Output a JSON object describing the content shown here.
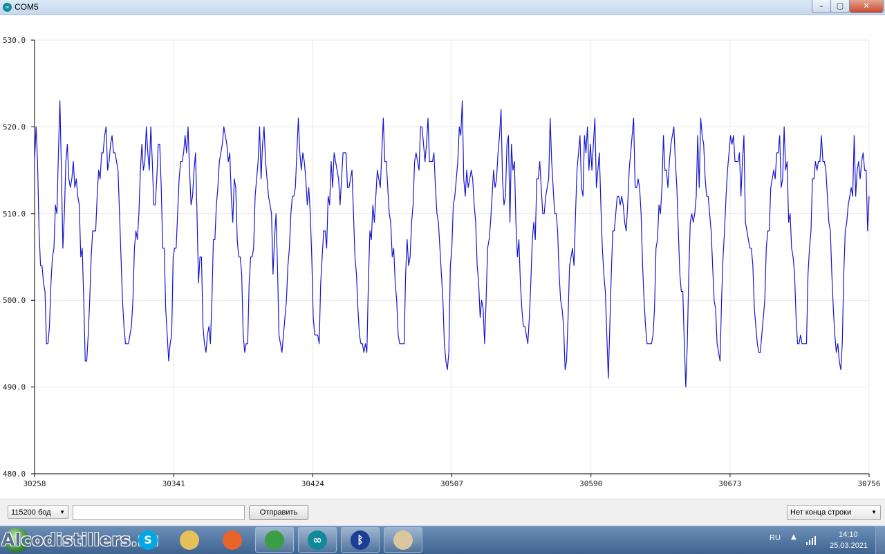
{
  "window": {
    "title": "COM5",
    "min_glyph": "–",
    "max_glyph": "▢",
    "close_glyph": "✕"
  },
  "chart_data": {
    "type": "line",
    "title": "",
    "xlabel": "",
    "ylabel": "",
    "xlim": [
      30258,
      30756
    ],
    "ylim": [
      480,
      530
    ],
    "x_ticks": [
      "30258",
      "30341",
      "30424",
      "30507",
      "30590",
      "30673",
      "30756"
    ],
    "y_ticks": [
      "480.0",
      "490.0",
      "500.0",
      "510.0",
      "520.0",
      "530.0"
    ],
    "grid": true,
    "series": [
      {
        "color": "#1515d0",
        "x_start": 30258,
        "x_step": 1,
        "values": [
          516,
          520,
          516,
          508,
          504,
          504,
          502,
          501,
          495,
          495,
          497,
          502,
          505,
          506,
          511,
          510,
          517,
          523,
          515,
          506,
          510,
          516,
          518,
          514,
          513,
          514,
          516,
          513,
          514,
          512,
          511,
          505,
          506,
          500,
          493,
          493,
          496,
          500,
          505,
          508,
          508,
          508,
          512,
          515,
          514,
          517,
          517,
          519,
          520,
          515,
          516,
          518,
          519,
          517,
          517,
          516,
          515,
          510,
          505,
          500,
          497,
          495,
          495,
          495,
          496,
          497,
          500,
          506,
          508,
          507,
          510,
          515,
          518,
          515,
          516,
          520,
          517,
          515,
          520,
          516,
          511,
          511,
          514,
          518,
          518,
          513,
          506,
          506,
          499,
          496,
          493,
          495,
          496,
          505,
          506,
          506,
          510,
          514,
          516,
          516,
          517,
          519,
          517,
          520,
          515,
          511,
          512,
          515,
          517,
          510,
          502,
          505,
          505,
          497,
          495,
          494,
          496,
          497,
          495,
          500,
          507,
          507,
          511,
          513,
          516,
          517,
          518,
          520,
          519,
          518,
          516,
          517,
          512,
          509,
          514,
          513,
          507,
          505,
          505,
          503,
          496,
          494,
          495,
          495,
          502,
          505,
          505,
          506,
          512,
          514,
          516,
          520,
          514,
          518,
          520,
          516,
          514,
          512,
          511,
          510,
          503,
          507,
          510,
          504,
          496,
          495,
          494,
          496,
          498,
          500,
          504,
          506,
          510,
          512,
          512,
          513,
          517,
          521,
          517,
          515,
          517,
          516,
          514,
          511,
          513,
          510,
          505,
          498,
          496,
          496,
          496,
          495,
          502,
          505,
          508,
          508,
          506,
          512,
          511,
          516,
          513,
          517,
          516,
          515,
          514,
          511,
          514,
          517,
          517,
          517,
          513,
          513,
          514,
          515,
          510,
          505,
          503,
          499,
          496,
          495,
          495,
          494,
          495,
          494,
          502,
          508,
          507,
          511,
          509,
          512,
          515,
          514,
          513,
          517,
          521,
          516,
          516,
          513,
          510,
          509,
          505,
          506,
          502,
          500,
          496,
          495,
          495,
          495,
          495,
          503,
          507,
          504,
          505,
          509,
          511,
          516,
          517,
          516,
          515,
          520,
          520,
          518,
          516,
          518,
          521,
          516,
          516,
          516,
          517,
          513,
          510,
          509,
          506,
          503,
          500,
          495,
          493,
          492,
          494,
          504,
          506,
          511,
          512,
          514,
          516,
          520,
          519,
          523,
          514,
          512,
          515,
          513,
          514,
          515,
          514,
          511,
          509,
          504,
          502,
          498,
          500,
          499,
          495,
          500,
          506,
          507,
          509,
          512,
          515,
          513,
          514,
          517,
          519,
          522,
          514,
          511,
          512,
          518,
          519,
          509,
          518,
          515,
          516,
          509,
          505,
          507,
          502,
          499,
          497,
          497,
          496,
          495,
          498,
          502,
          507,
          509,
          507,
          514,
          514,
          516,
          513,
          510,
          510,
          512,
          513,
          514,
          521,
          516,
          513,
          510,
          510,
          508,
          503,
          500,
          499,
          497,
          492,
          493,
          498,
          504,
          505,
          506,
          504,
          510,
          515,
          517,
          519,
          513,
          512,
          519,
          517,
          520,
          515,
          518,
          515,
          518,
          521,
          513,
          515,
          517,
          511,
          506,
          503,
          501,
          496,
          491,
          497,
          503,
          508,
          508,
          510,
          512,
          512,
          511,
          512,
          511,
          509,
          508,
          511,
          515,
          517,
          519,
          521,
          513,
          513,
          514,
          513,
          510,
          504,
          500,
          497,
          495,
          495,
          495,
          495,
          496,
          499,
          506,
          507,
          511,
          510,
          513,
          519,
          515,
          515,
          513,
          516,
          518,
          519,
          520,
          516,
          513,
          508,
          503,
          501,
          501,
          495,
          490,
          495,
          503,
          509,
          510,
          509,
          510,
          512,
          519,
          513,
          521,
          519,
          518,
          514,
          512,
          512,
          510,
          508,
          504,
          500,
          499,
          495,
          494,
          493,
          500,
          505,
          508,
          512,
          515,
          517,
          519,
          518,
          519,
          516,
          516,
          516,
          517,
          512,
          516,
          519,
          509,
          508,
          507,
          506,
          506,
          504,
          499,
          497,
          495,
          494,
          494,
          496,
          498,
          500,
          506,
          508,
          508,
          513,
          514,
          515,
          514,
          517,
          517,
          519,
          513,
          514,
          520,
          515,
          516,
          509,
          510,
          506,
          505,
          503,
          498,
          495,
          495,
          496,
          495,
          495,
          495,
          495,
          503,
          506,
          508,
          514,
          514,
          516,
          515,
          516,
          516,
          519,
          516,
          516,
          515,
          512,
          509,
          508,
          503,
          499,
          496,
          494,
          495,
          493,
          492,
          495,
          503,
          508,
          509,
          511,
          512,
          513,
          512,
          519,
          512,
          515,
          516,
          514,
          516,
          517,
          515,
          515,
          508,
          512
        ]
      }
    ]
  },
  "controls": {
    "baud_label": "115200 бод",
    "input_value": "",
    "send_label": "Отправить",
    "eol_label": "Нет конца строки",
    "dropdown_arrow": "▼"
  },
  "taskbar": {
    "watermark": "Alcodistillers.ru",
    "apps": [
      {
        "name": "skype-icon",
        "glyph": "S",
        "color": "#00a8e6"
      },
      {
        "name": "folder-icon",
        "glyph": "",
        "color": "#e6c15a"
      },
      {
        "name": "firefox-icon",
        "glyph": "",
        "color": "#e8642a"
      },
      {
        "name": "chrome-icon",
        "glyph": "",
        "color": "#3b9e44"
      },
      {
        "name": "arduino-icon",
        "glyph": "∞",
        "color": "#0f8a9a"
      },
      {
        "name": "bluetooth-icon",
        "glyph": "ᛒ",
        "color": "#1b3e96"
      },
      {
        "name": "paint-icon",
        "glyph": "",
        "color": "#d9c7a0"
      }
    ],
    "language": "RU",
    "tray_arrow": "▲",
    "time": "14:10",
    "date": "25.03.2021"
  }
}
